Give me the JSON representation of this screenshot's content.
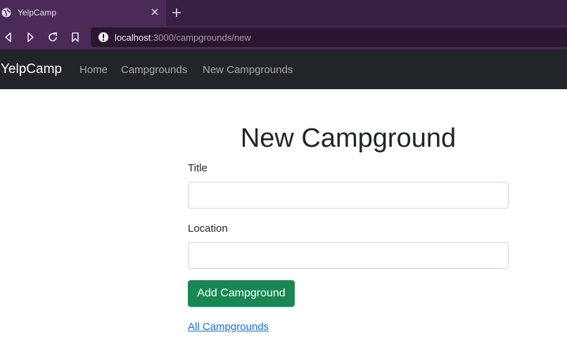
{
  "browser": {
    "tab_title": "YelpCamp",
    "url_host": "localhost",
    "url_rest": ":3000/campgrounds/new"
  },
  "navbar": {
    "brand": "YelpCamp",
    "links": [
      "Home",
      "Campgrounds",
      "New Campgrounds"
    ]
  },
  "form": {
    "heading": "New Campground",
    "title_label": "Title",
    "title_value": "",
    "location_label": "Location",
    "location_value": "",
    "submit_label": "Add Campground",
    "back_link": "All Campgrounds"
  },
  "colors": {
    "navbar_bg": "#212529",
    "submit_bg": "#198754",
    "link": "#0d6efd"
  }
}
